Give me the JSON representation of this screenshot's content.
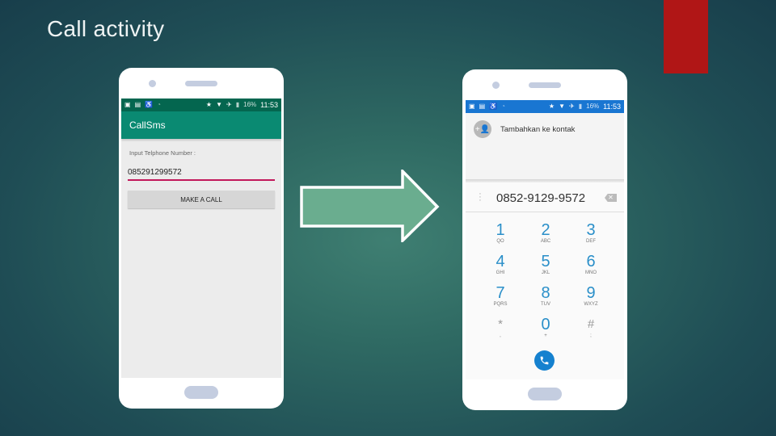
{
  "slide": {
    "title": "Call activity",
    "accent_color": "#b01616"
  },
  "left_phone": {
    "status_bar": {
      "battery": "16%",
      "time": "11:53",
      "icons": [
        "image-icon",
        "gallery-icon",
        "accessibility-icon",
        "wifi-off-icon",
        "star-icon",
        "wifi-icon",
        "airplane-icon",
        "battery-icon"
      ]
    },
    "app_title": "CallSms",
    "input_label": "Input Telphone Number :",
    "input_value": "085291299572",
    "call_button": "MAKE A CALL",
    "colors": {
      "status": "#04664f",
      "appbar": "#0a8a72",
      "underline": "#c2185b"
    }
  },
  "right_phone": {
    "status_bar": {
      "battery": "16%",
      "time": "11:53"
    },
    "add_contact": "Tambahkan ke kontak",
    "dialed_number": "0852-9129-9572",
    "keys": [
      {
        "digit": "1",
        "letters": "QO"
      },
      {
        "digit": "2",
        "letters": "ABC"
      },
      {
        "digit": "3",
        "letters": "DEF"
      },
      {
        "digit": "4",
        "letters": "GHI"
      },
      {
        "digit": "5",
        "letters": "JKL"
      },
      {
        "digit": "6",
        "letters": "MNO"
      },
      {
        "digit": "7",
        "letters": "PQRS"
      },
      {
        "digit": "8",
        "letters": "TUV"
      },
      {
        "digit": "9",
        "letters": "WXYZ"
      },
      {
        "digit": "*",
        "letters": ","
      },
      {
        "digit": "0",
        "letters": "+"
      },
      {
        "digit": "#",
        "letters": ";"
      }
    ],
    "colors": {
      "status": "#1976d2",
      "digits": "#2a8fc9",
      "dial_button": "#1581cf"
    }
  }
}
